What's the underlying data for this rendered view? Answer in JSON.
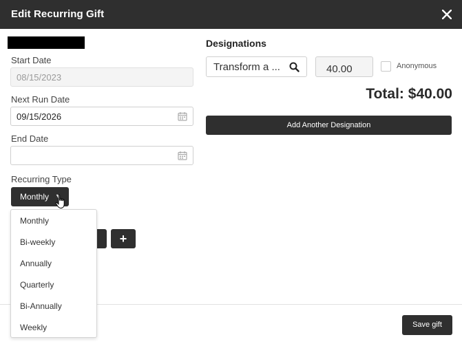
{
  "modal": {
    "title": "Edit Recurring Gift",
    "close_icon": "close-icon"
  },
  "form": {
    "start_date": {
      "label": "Start Date",
      "value": "08/15/2023"
    },
    "next_run_date": {
      "label": "Next Run Date",
      "value": "09/15/2026"
    },
    "end_date": {
      "label": "End Date",
      "value": ""
    },
    "recurring_type": {
      "label": "Recurring Type",
      "selected": "Monthly",
      "options": [
        "Monthly",
        "Bi-weekly",
        "Annually",
        "Quarterly",
        "Bi-Annually",
        "Weekly"
      ]
    },
    "plus_label": "+"
  },
  "designations": {
    "title": "Designations",
    "items": [
      {
        "name": "Transform a ...",
        "amount": "40.00",
        "anonymous_label": "Anonymous",
        "anonymous_checked": false
      }
    ],
    "total": "Total: $40.00",
    "add_button_label": "Add Another Designation"
  },
  "footer": {
    "save_label": "Save gift"
  },
  "colors": {
    "header_bg": "#2f2f2f",
    "button_bg": "#2f2f2f",
    "text": "#333333"
  }
}
